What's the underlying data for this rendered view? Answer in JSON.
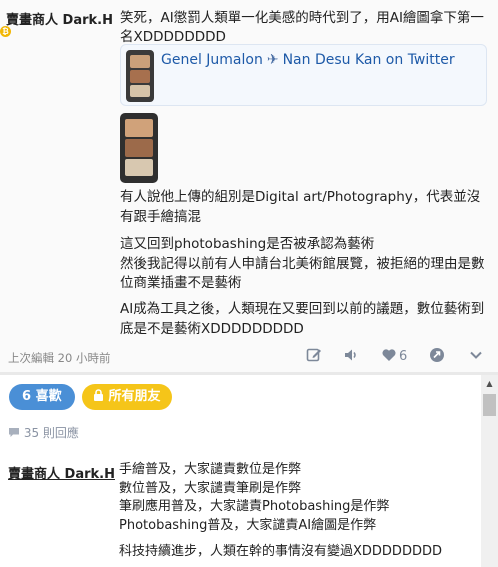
{
  "post": {
    "author": "賣畫商人 Dark.H",
    "author_badge": "₿",
    "intro": "笑死，AI懲罰人類單一化美感的時代到了，用AI繪圖拿下第一名XDDDDDDDD",
    "link": {
      "name1": "Genel Jumalon",
      "plane_icon": "✈",
      "name2": "Nan Desu Kan on Twitter"
    },
    "p1": "有人說他上傳的組別是Digital art/Photography，代表並沒有跟手繪搞混",
    "p2a": "這又回到photobashing是否被承認為藝術",
    "p2b": "然後我記得以前有人申請台北美術館展覽，被拒絕的理由是數位商業插畫不是藝術",
    "p3": "AI成為工具之後，人類現在又要回到以前的議題，數位藝術到底是不是藝術XDDDDDDDDD",
    "edited": "上次編輯 20 小時前",
    "like_count": "6"
  },
  "comments": {
    "likes_label": "6 喜歡",
    "friends_label": "所有朋友",
    "replies_label": "35 則回應",
    "author": "賣畫商人 Dark.H",
    "lines": [
      "手繪普及，大家譴責數位是作弊",
      "數位普及，大家譴責筆刷是作弊",
      "筆刷應用普及，大家譴責Photobashing是作弊",
      "Photobashing普及，大家譴責AI繪圖是作弊"
    ],
    "last": "科技持續進步，人類在幹的事情沒有變過XDDDDDDDD"
  },
  "colors": {
    "accent_blue": "#4a8fd6",
    "friends_yellow": "#f5c519",
    "link_blue": "#1e5aa8",
    "icon_gray": "#7d8899"
  }
}
